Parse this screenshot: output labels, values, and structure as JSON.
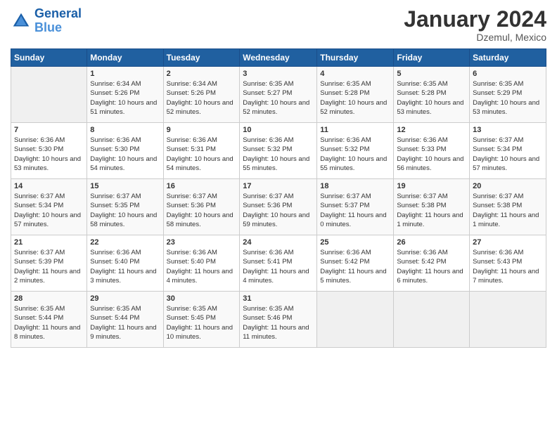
{
  "header": {
    "logo_line1": "General",
    "logo_line2": "Blue",
    "month_year": "January 2024",
    "location": "Dzemul, Mexico"
  },
  "weekdays": [
    "Sunday",
    "Monday",
    "Tuesday",
    "Wednesday",
    "Thursday",
    "Friday",
    "Saturday"
  ],
  "weeks": [
    [
      {
        "day": "",
        "sunrise": "",
        "sunset": "",
        "daylight": ""
      },
      {
        "day": "1",
        "sunrise": "Sunrise: 6:34 AM",
        "sunset": "Sunset: 5:26 PM",
        "daylight": "Daylight: 10 hours and 51 minutes."
      },
      {
        "day": "2",
        "sunrise": "Sunrise: 6:34 AM",
        "sunset": "Sunset: 5:26 PM",
        "daylight": "Daylight: 10 hours and 52 minutes."
      },
      {
        "day": "3",
        "sunrise": "Sunrise: 6:35 AM",
        "sunset": "Sunset: 5:27 PM",
        "daylight": "Daylight: 10 hours and 52 minutes."
      },
      {
        "day": "4",
        "sunrise": "Sunrise: 6:35 AM",
        "sunset": "Sunset: 5:28 PM",
        "daylight": "Daylight: 10 hours and 52 minutes."
      },
      {
        "day": "5",
        "sunrise": "Sunrise: 6:35 AM",
        "sunset": "Sunset: 5:28 PM",
        "daylight": "Daylight: 10 hours and 53 minutes."
      },
      {
        "day": "6",
        "sunrise": "Sunrise: 6:35 AM",
        "sunset": "Sunset: 5:29 PM",
        "daylight": "Daylight: 10 hours and 53 minutes."
      }
    ],
    [
      {
        "day": "7",
        "sunrise": "Sunrise: 6:36 AM",
        "sunset": "Sunset: 5:30 PM",
        "daylight": "Daylight: 10 hours and 53 minutes."
      },
      {
        "day": "8",
        "sunrise": "Sunrise: 6:36 AM",
        "sunset": "Sunset: 5:30 PM",
        "daylight": "Daylight: 10 hours and 54 minutes."
      },
      {
        "day": "9",
        "sunrise": "Sunrise: 6:36 AM",
        "sunset": "Sunset: 5:31 PM",
        "daylight": "Daylight: 10 hours and 54 minutes."
      },
      {
        "day": "10",
        "sunrise": "Sunrise: 6:36 AM",
        "sunset": "Sunset: 5:32 PM",
        "daylight": "Daylight: 10 hours and 55 minutes."
      },
      {
        "day": "11",
        "sunrise": "Sunrise: 6:36 AM",
        "sunset": "Sunset: 5:32 PM",
        "daylight": "Daylight: 10 hours and 55 minutes."
      },
      {
        "day": "12",
        "sunrise": "Sunrise: 6:36 AM",
        "sunset": "Sunset: 5:33 PM",
        "daylight": "Daylight: 10 hours and 56 minutes."
      },
      {
        "day": "13",
        "sunrise": "Sunrise: 6:37 AM",
        "sunset": "Sunset: 5:34 PM",
        "daylight": "Daylight: 10 hours and 57 minutes."
      }
    ],
    [
      {
        "day": "14",
        "sunrise": "Sunrise: 6:37 AM",
        "sunset": "Sunset: 5:34 PM",
        "daylight": "Daylight: 10 hours and 57 minutes."
      },
      {
        "day": "15",
        "sunrise": "Sunrise: 6:37 AM",
        "sunset": "Sunset: 5:35 PM",
        "daylight": "Daylight: 10 hours and 58 minutes."
      },
      {
        "day": "16",
        "sunrise": "Sunrise: 6:37 AM",
        "sunset": "Sunset: 5:36 PM",
        "daylight": "Daylight: 10 hours and 58 minutes."
      },
      {
        "day": "17",
        "sunrise": "Sunrise: 6:37 AM",
        "sunset": "Sunset: 5:36 PM",
        "daylight": "Daylight: 10 hours and 59 minutes."
      },
      {
        "day": "18",
        "sunrise": "Sunrise: 6:37 AM",
        "sunset": "Sunset: 5:37 PM",
        "daylight": "Daylight: 11 hours and 0 minutes."
      },
      {
        "day": "19",
        "sunrise": "Sunrise: 6:37 AM",
        "sunset": "Sunset: 5:38 PM",
        "daylight": "Daylight: 11 hours and 1 minute."
      },
      {
        "day": "20",
        "sunrise": "Sunrise: 6:37 AM",
        "sunset": "Sunset: 5:38 PM",
        "daylight": "Daylight: 11 hours and 1 minute."
      }
    ],
    [
      {
        "day": "21",
        "sunrise": "Sunrise: 6:37 AM",
        "sunset": "Sunset: 5:39 PM",
        "daylight": "Daylight: 11 hours and 2 minutes."
      },
      {
        "day": "22",
        "sunrise": "Sunrise: 6:36 AM",
        "sunset": "Sunset: 5:40 PM",
        "daylight": "Daylight: 11 hours and 3 minutes."
      },
      {
        "day": "23",
        "sunrise": "Sunrise: 6:36 AM",
        "sunset": "Sunset: 5:40 PM",
        "daylight": "Daylight: 11 hours and 4 minutes."
      },
      {
        "day": "24",
        "sunrise": "Sunrise: 6:36 AM",
        "sunset": "Sunset: 5:41 PM",
        "daylight": "Daylight: 11 hours and 4 minutes."
      },
      {
        "day": "25",
        "sunrise": "Sunrise: 6:36 AM",
        "sunset": "Sunset: 5:42 PM",
        "daylight": "Daylight: 11 hours and 5 minutes."
      },
      {
        "day": "26",
        "sunrise": "Sunrise: 6:36 AM",
        "sunset": "Sunset: 5:42 PM",
        "daylight": "Daylight: 11 hours and 6 minutes."
      },
      {
        "day": "27",
        "sunrise": "Sunrise: 6:36 AM",
        "sunset": "Sunset: 5:43 PM",
        "daylight": "Daylight: 11 hours and 7 minutes."
      }
    ],
    [
      {
        "day": "28",
        "sunrise": "Sunrise: 6:35 AM",
        "sunset": "Sunset: 5:44 PM",
        "daylight": "Daylight: 11 hours and 8 minutes."
      },
      {
        "day": "29",
        "sunrise": "Sunrise: 6:35 AM",
        "sunset": "Sunset: 5:44 PM",
        "daylight": "Daylight: 11 hours and 9 minutes."
      },
      {
        "day": "30",
        "sunrise": "Sunrise: 6:35 AM",
        "sunset": "Sunset: 5:45 PM",
        "daylight": "Daylight: 11 hours and 10 minutes."
      },
      {
        "day": "31",
        "sunrise": "Sunrise: 6:35 AM",
        "sunset": "Sunset: 5:46 PM",
        "daylight": "Daylight: 11 hours and 11 minutes."
      },
      {
        "day": "",
        "sunrise": "",
        "sunset": "",
        "daylight": ""
      },
      {
        "day": "",
        "sunrise": "",
        "sunset": "",
        "daylight": ""
      },
      {
        "day": "",
        "sunrise": "",
        "sunset": "",
        "daylight": ""
      }
    ]
  ]
}
